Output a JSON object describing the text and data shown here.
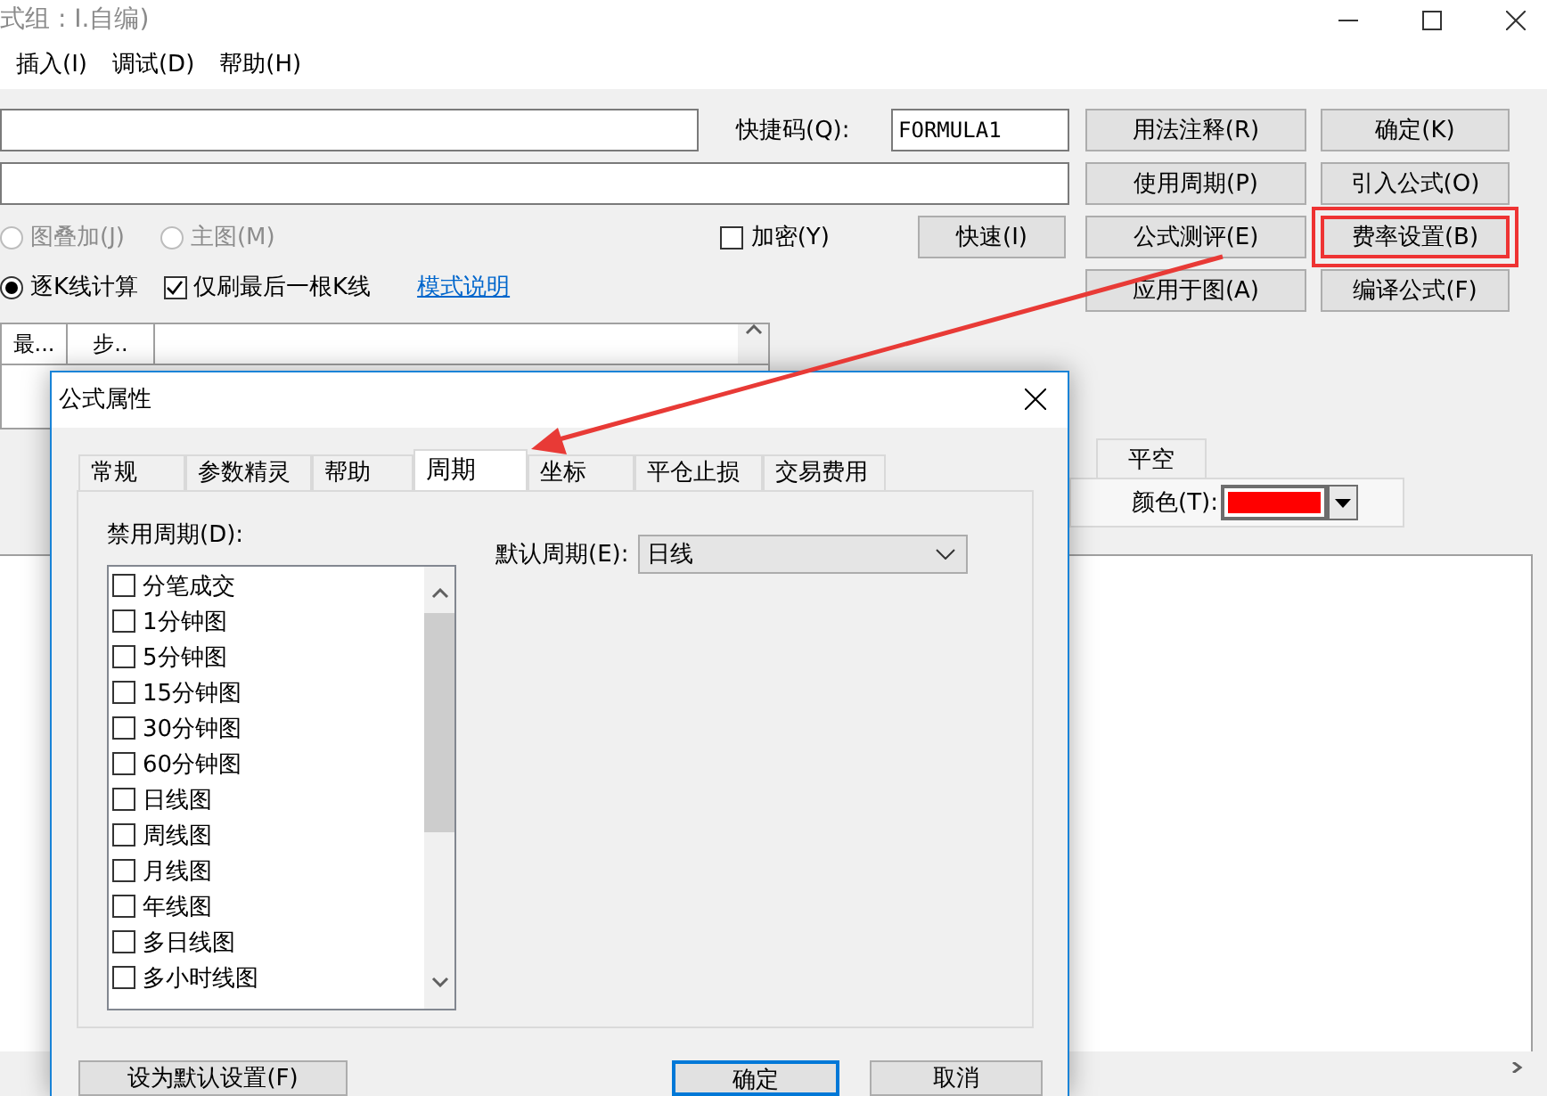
{
  "window": {
    "title": "式组 : I.自编)"
  },
  "menu": [
    "插入(I)",
    "调试(D)",
    "帮助(H)"
  ],
  "form": {
    "shortcut": {
      "label": "快捷码(Q):",
      "value": "FORMULA1"
    },
    "overlay_radio": {
      "label": "图叠加(J)",
      "selected": false,
      "disabled": true
    },
    "main_radio": {
      "label": "主图(M)",
      "selected": false,
      "disabled": true
    },
    "encrypt": {
      "label": "加密(Y)",
      "checked": false
    },
    "fast_button": "快速(I)",
    "mode_radio": {
      "label": "逐K线计算",
      "selected": true,
      "disabled": false
    },
    "refresh_last": {
      "label": "仅刷最后一根K线",
      "checked": true
    },
    "mode_link": "模式说明"
  },
  "buttons": [
    {
      "label": "用法注释(R)",
      "highlighted": false
    },
    {
      "label": "确定(K)",
      "highlighted": false
    },
    {
      "label": "使用周期(P)",
      "highlighted": false
    },
    {
      "label": "引入公式(O)",
      "highlighted": false
    },
    {
      "label": "公式测评(E)",
      "highlighted": false
    },
    {
      "label": "费率设置(B)",
      "highlighted": true
    },
    {
      "label": "应用于图(A)",
      "highlighted": false
    },
    {
      "label": "编译公式(F)",
      "highlighted": false
    }
  ],
  "table": {
    "columns": [
      "最...",
      "步.."
    ]
  },
  "back_tab": "平空",
  "color_field": {
    "label": "颜色(T):",
    "color": "#ff0000"
  },
  "dialog": {
    "title": "公式属性",
    "tabs": [
      {
        "label": "常规",
        "selected": false
      },
      {
        "label": "参数精灵",
        "selected": false
      },
      {
        "label": "帮助",
        "selected": false
      },
      {
        "label": "周期",
        "selected": true
      },
      {
        "label": "坐标",
        "selected": false
      },
      {
        "label": "平仓止损",
        "selected": false
      },
      {
        "label": "交易费用",
        "selected": false
      }
    ],
    "disabled_periods": {
      "label": "禁用周期(D):",
      "items": [
        {
          "label": "分笔成交",
          "checked": false
        },
        {
          "label": "1分钟图",
          "checked": false
        },
        {
          "label": "5分钟图",
          "checked": false
        },
        {
          "label": "15分钟图",
          "checked": false
        },
        {
          "label": "30分钟图",
          "checked": false
        },
        {
          "label": "60分钟图",
          "checked": false
        },
        {
          "label": "日线图",
          "checked": false
        },
        {
          "label": "周线图",
          "checked": false
        },
        {
          "label": "月线图",
          "checked": false
        },
        {
          "label": "年线图",
          "checked": false
        },
        {
          "label": "多日线图",
          "checked": false
        },
        {
          "label": "多小时线图",
          "checked": false
        }
      ]
    },
    "default_period": {
      "label": "默认周期(E):",
      "value": "日线"
    },
    "buttons": [
      {
        "label": "设为默认设置(F)",
        "kind": "secondary"
      },
      {
        "label": "确定",
        "kind": "default"
      },
      {
        "label": "取消",
        "kind": "normal"
      }
    ]
  }
}
